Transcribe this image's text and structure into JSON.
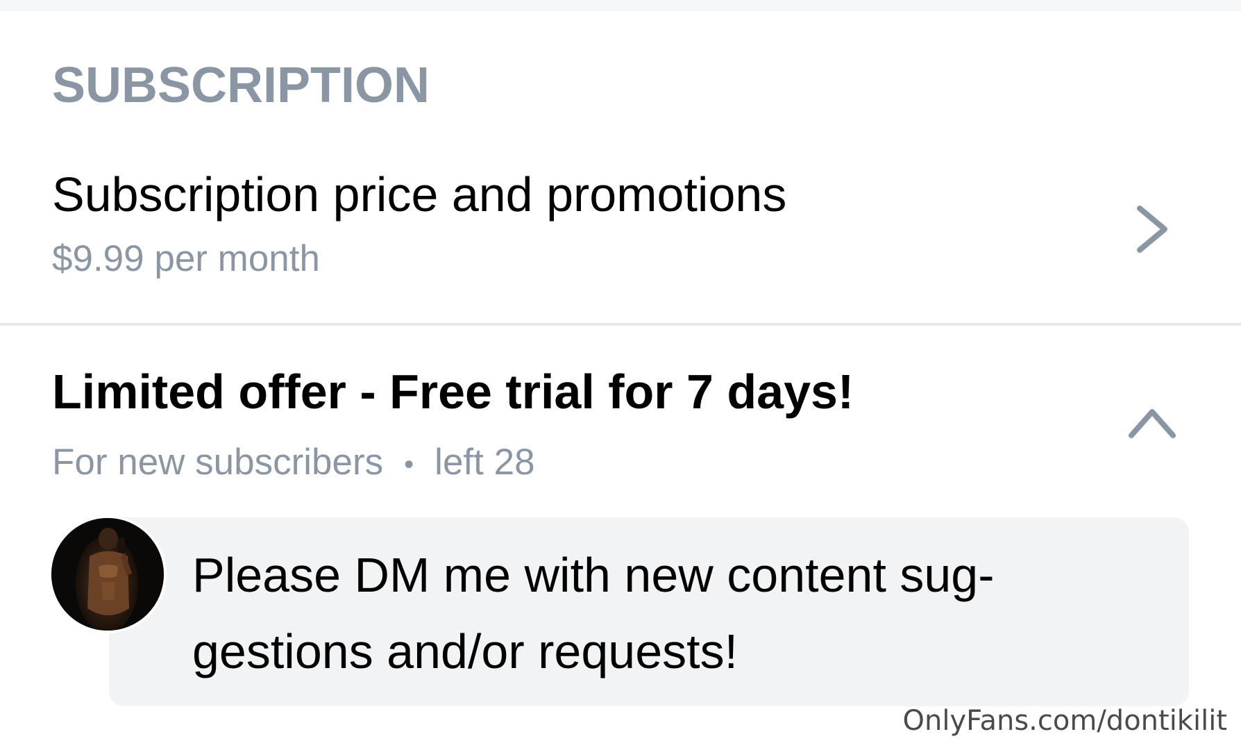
{
  "section": {
    "header": "SUBSCRIPTION"
  },
  "subscription_row": {
    "title": "Subscription price and promotions",
    "price": "$9.99 per month",
    "icon": "chevron-right-icon"
  },
  "offer_row": {
    "title": "Limited offer - Free trial for 7 days!",
    "audience": "For new subscribers",
    "separator": "•",
    "remaining": "left 28",
    "icon": "chevron-up-icon"
  },
  "message": {
    "text": "Please DM me with new content sug-gestions and/or requests!",
    "avatar": "profile-avatar"
  },
  "watermark": {
    "text": "OnlyFans.com/dontikilit"
  },
  "colors": {
    "muted_text": "#8a96a3",
    "primary_text": "#000000",
    "bubble_bg": "#f2f3f4",
    "divider": "#e6e9ec"
  }
}
